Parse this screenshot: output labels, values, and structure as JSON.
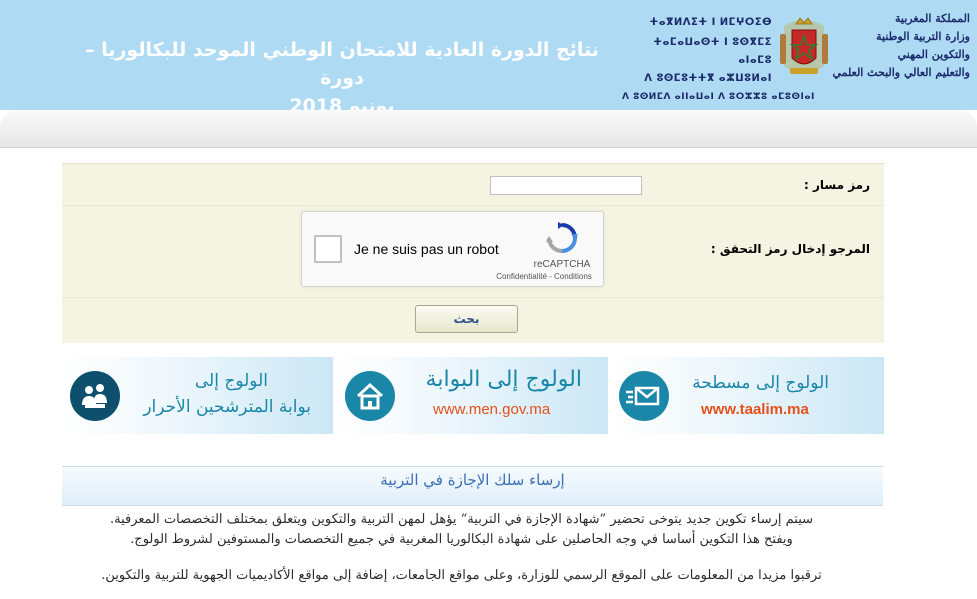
{
  "header": {
    "title_line1": "نتائج الدورة العادية للامتحان الوطني الموحد للبكالوريا – دورة",
    "title_line2": "يونيو 2018",
    "tifinagh": [
      "ⵜⴰⴳⵍⴷⵉⵜ ⵏ ⵍⵎⵖⵔⵉⴱ",
      "ⵜⴰⵎⴰⵡⴰⵙⵜ ⵏ ⵓⵙⴳⵎⵉ ⴰⵏⴰⵎⵓ",
      "ⴷ ⵓⵙⵎⵓⵜⵜⴳ ⴰⵣⵡⵓⵍⴰⵏ",
      "ⴷ ⵓⵙⵍⵎⴷ ⴰⵏⵏⴰⵡⴰⵏ ⴷ ⵓⵔⵣⵣⵓ ⴰⵎⵓⵙⵏⴰⵏ"
    ],
    "org": [
      "المملكة المغربية",
      "وزارة التربية الوطنية",
      "والتكوين المهني",
      "والتعليم العالي والبحث العلمي"
    ]
  },
  "form": {
    "massar_label": "رمز مسار :",
    "massar_value": "",
    "captcha_label": "المرجو إدخال رمز التحقق :",
    "captcha": {
      "checkbox_label": "Je ne suis pas un robot",
      "brand": "reCAPTCHA",
      "links": "Confidentialité - Conditions"
    },
    "search_label": "بحث"
  },
  "banners": {
    "taalim": {
      "title": "الولوج إلى مسطحة",
      "url": "www.taalim.ma"
    },
    "men": {
      "title": "الولوج إلى البوابة",
      "url": "www.men.gov.ma"
    },
    "libre": {
      "title_line1": "الولوج إلى",
      "title_line2": "بوابة المترشحين الأحرار"
    }
  },
  "info": {
    "title": "إرساء سلك الإجازة في التربية",
    "para1_line1": "سيتم إرساء تكوين جديد يتوخى تحضير ”شهادة الإجازة في التربية“ يؤهل لمهن التربية والتكوين ويتعلق بمختلف التخصصات المعرفية.",
    "para1_line2": "ويفتح هذا التكوين أساسا في وجه الحاصلين على شهادة البكالوريا المغربية في جميع التخصصات والمستوفين لشروط الولوج.",
    "para2": "ترقبوا مزيدا من المعلومات على الموقع الرسمي للوزارة، وعلى مواقع الجامعات، إضافة إلى مواقع الأكاديميات الجهوية للتربية والتكوين."
  },
  "colors": {
    "header_bg": "#aedaf3",
    "form_bg": "#f5f3e1",
    "accent_blue": "#3b6fb5",
    "teal": "#1a86a8",
    "url_orange": "#e4501c",
    "emblem_red": "#c62828",
    "emblem_gold": "#c9a227",
    "emblem_green": "#2e7d32"
  }
}
